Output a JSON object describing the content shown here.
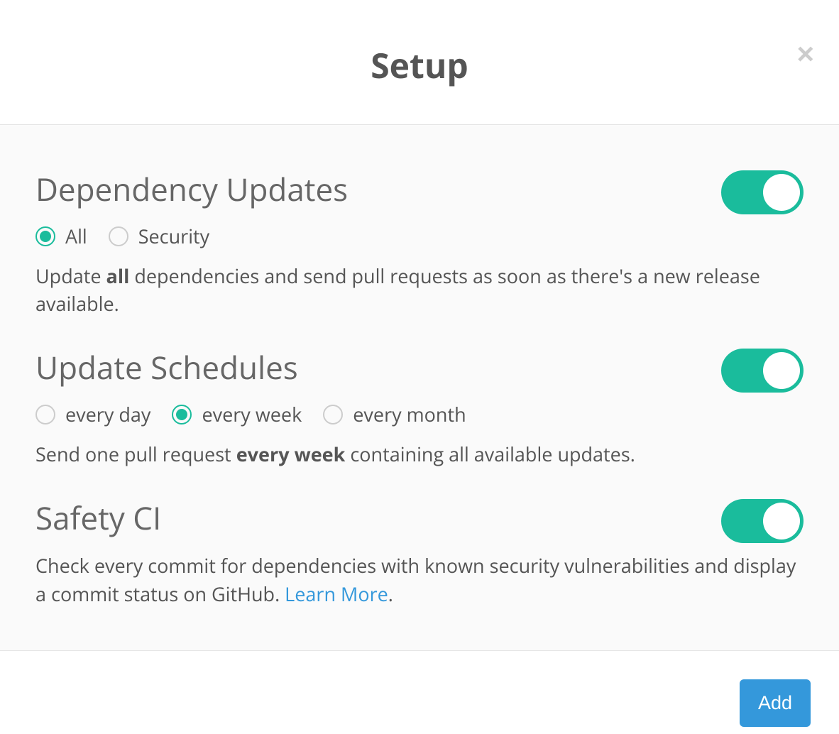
{
  "header": {
    "title": "Setup"
  },
  "sections": {
    "dependency_updates": {
      "title": "Dependency Updates",
      "toggle_on": true,
      "options": [
        {
          "label": "All",
          "selected": true
        },
        {
          "label": "Security",
          "selected": false
        }
      ],
      "description_pre": "Update ",
      "description_bold": "all",
      "description_post": " dependencies and send pull requests as soon as there's a new release available."
    },
    "update_schedules": {
      "title": "Update Schedules",
      "toggle_on": true,
      "options": [
        {
          "label": "every day",
          "selected": false
        },
        {
          "label": "every week",
          "selected": true
        },
        {
          "label": "every month",
          "selected": false
        }
      ],
      "description_pre": "Send one pull request ",
      "description_bold": "every week",
      "description_post": " containing all available updates."
    },
    "safety_ci": {
      "title": "Safety CI",
      "toggle_on": true,
      "description": "Check every commit for dependencies with known security vulnerabilities and display a commit status on GitHub. ",
      "learn_more_label": "Learn More",
      "description_suffix": "."
    }
  },
  "footer": {
    "add_label": "Add"
  }
}
